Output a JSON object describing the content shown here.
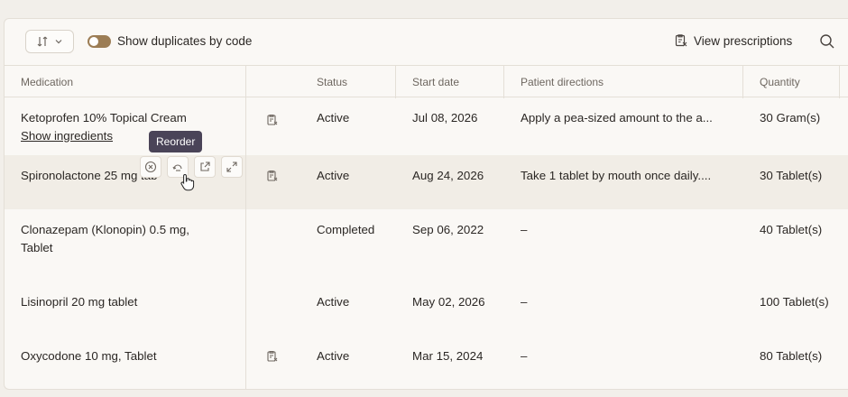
{
  "toolbar": {
    "toggle_label": "Show duplicates by code",
    "view_prescriptions_label": "View prescriptions"
  },
  "columns": {
    "medication": "Medication",
    "status": "Status",
    "start_date": "Start date",
    "patient_directions": "Patient directions",
    "quantity": "Quantity"
  },
  "rows": [
    {
      "med_line1": "Ketoprofen 10% Topical Cream",
      "med_line2": "Show ingredients",
      "status": "Active",
      "start": "Jul 08, 2026",
      "directions": "Apply a pea-sized amount to the a...",
      "qty": "30 Gram(s)"
    },
    {
      "med_line1": "Spironolactone 25 mg tab",
      "status": "Active",
      "start": "Aug 24, 2026",
      "directions": "Take 1 tablet by mouth once daily....",
      "qty": "30 Tablet(s)"
    },
    {
      "med_line1": "Clonazepam (Klonopin) 0.5 mg,",
      "med_line2": "Tablet",
      "status": "Completed",
      "start": "Sep 06, 2022",
      "directions": "–",
      "qty": "40 Tablet(s)"
    },
    {
      "med_line1": "Lisinopril 20 mg tablet",
      "status": "Active",
      "start": "May 02, 2026",
      "directions": "–",
      "qty": "100 Tablet(s)"
    },
    {
      "med_line1": "Oxycodone 10 mg, Tablet",
      "status": "Active",
      "start": "Mar 15, 2024",
      "directions": "–",
      "qty": "80 Tablet(s)"
    }
  ],
  "tooltip": "Reorder"
}
